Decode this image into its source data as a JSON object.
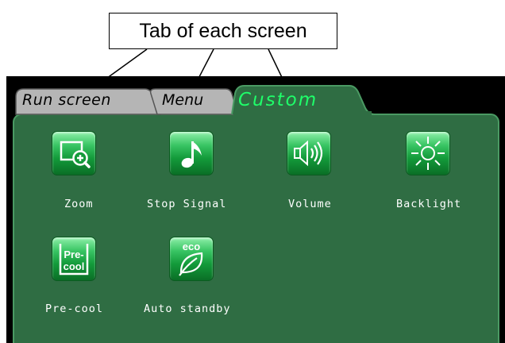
{
  "callout": {
    "text": "Tab of each screen"
  },
  "tabs": [
    {
      "label": "Run screen",
      "active": false
    },
    {
      "label": "Menu",
      "active": false
    },
    {
      "label": "Custom",
      "active": true
    }
  ],
  "items": [
    {
      "label": "Zoom",
      "icon": "zoom-icon"
    },
    {
      "label": "Stop Signal",
      "icon": "music-note-icon"
    },
    {
      "label": "Volume",
      "icon": "speaker-icon"
    },
    {
      "label": "Backlight",
      "icon": "sun-icon"
    },
    {
      "label": "Pre-cool",
      "icon": "pre-cool-icon",
      "icon_text": [
        "Pre-",
        "cool"
      ]
    },
    {
      "label": "Auto standby",
      "icon": "eco-leaf-icon",
      "icon_text": "eco"
    }
  ],
  "colors": {
    "panel_green": "#2f6d43",
    "active_tab_text": "#1fff6a",
    "tile_green": "#139a3a"
  }
}
